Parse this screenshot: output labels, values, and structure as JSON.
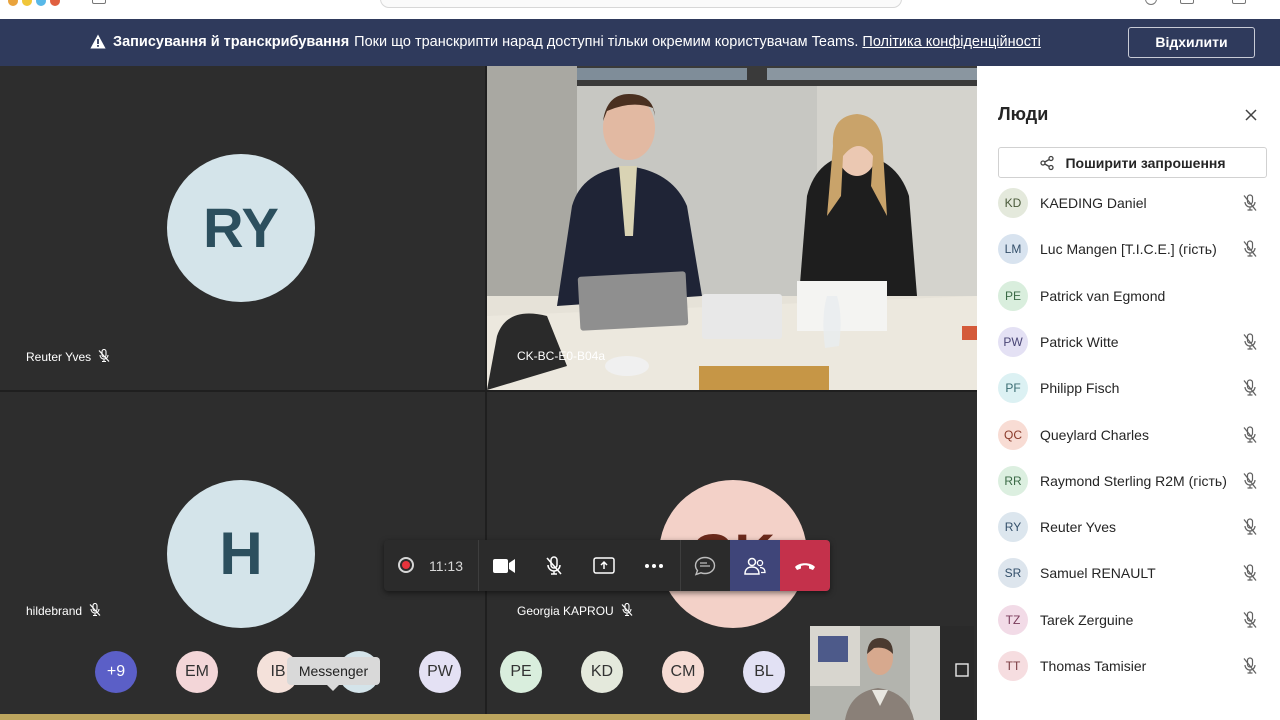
{
  "colors": {
    "banner_bg": "#2f3a5c",
    "tile_bg": "#2d2d2d",
    "accent_active": "#3f4579",
    "hangup": "#c4314b",
    "record_dot": "#e5333c"
  },
  "banner": {
    "bold": "Записування й транскрибування",
    "text": "Поки що транскрипти нарад доступні тільки окремим користувачам Teams.",
    "link": "Політика конфіденційності",
    "dismiss": "Відхилити"
  },
  "tiles": [
    {
      "initials": "RY",
      "name": "Reuter Yves",
      "avatar_color": "#d4e4ea",
      "muted": true
    },
    {
      "name": "CK-BC-E0-B04a",
      "is_video": true
    },
    {
      "initials": "H",
      "name": "hildebrand",
      "avatar_color": "#d4e4ea",
      "muted": true
    },
    {
      "initials": "GK",
      "name": "Georgia KAPROU",
      "avatar_color": "#f3d1c8",
      "muted": true
    }
  ],
  "controls": {
    "timer": "11:13",
    "icons": [
      "record-icon",
      "camera-icon",
      "mic-off-icon",
      "share-screen-icon",
      "more-icon",
      "chat-icon",
      "people-icon",
      "hangup-icon"
    ]
  },
  "overflow": [
    {
      "label": "+9",
      "color": "#5b5fc7",
      "text_color": "#ffffff"
    },
    {
      "label": "EM",
      "color": "#f3d6d8",
      "text_color": "#333333"
    },
    {
      "label": "IB",
      "color": "#f4e1da",
      "text_color": "#333333"
    },
    {
      "label": "",
      "color": "#d4e4ea",
      "text_color": "#333333"
    },
    {
      "label": "PW",
      "color": "#e4e1f4",
      "text_color": "#333333"
    },
    {
      "label": "PE",
      "color": "#d9eedd",
      "text_color": "#333333"
    },
    {
      "label": "KD",
      "color": "#e4e9dc",
      "text_color": "#333333"
    },
    {
      "label": "CM",
      "color": "#f6dcd4",
      "text_color": "#333333"
    },
    {
      "label": "BL",
      "color": "#e2e1f4",
      "text_color": "#333333"
    }
  ],
  "tooltip": "Messenger",
  "panel": {
    "title": "Люди",
    "share": "Поширити запрошення",
    "people": [
      {
        "initials": "KD",
        "name": "KAEDING Daniel",
        "color": "#e4e9dc",
        "text_color": "#4a5a3a",
        "muted": true
      },
      {
        "initials": "LM",
        "name": "Luc Mangen [T.I.C.E.] (гість)",
        "color": "#d8e3ef",
        "text_color": "#34506b",
        "muted": true
      },
      {
        "initials": "PE",
        "name": "Patrick van Egmond",
        "color": "#d9eedd",
        "text_color": "#3b6a46",
        "muted": false
      },
      {
        "initials": "PW",
        "name": "Patrick Witte",
        "color": "#e4e1f4",
        "text_color": "#4a4676",
        "muted": true
      },
      {
        "initials": "PF",
        "name": "Philipp Fisch",
        "color": "#dcf1f3",
        "text_color": "#3a6c72",
        "muted": true
      },
      {
        "initials": "QC",
        "name": "Queylard Charles",
        "color": "#f8dcd4",
        "text_color": "#8a3a2a",
        "muted": true
      },
      {
        "initials": "RR",
        "name": "Raymond Sterling R2M (гість)",
        "color": "#dcefe0",
        "text_color": "#3b6a46",
        "muted": true
      },
      {
        "initials": "RY",
        "name": "Reuter Yves",
        "color": "#dce6ee",
        "text_color": "#34506b",
        "muted": true
      },
      {
        "initials": "SR",
        "name": "Samuel RENAULT",
        "color": "#dde5ed",
        "text_color": "#34506b",
        "muted": true
      },
      {
        "initials": "TZ",
        "name": "Tarek Zerguine",
        "color": "#f2dbe7",
        "text_color": "#7a3a5a",
        "muted": true
      },
      {
        "initials": "TT",
        "name": "Thomas Tamisier",
        "color": "#f6dde0",
        "text_color": "#7a3a40",
        "muted": true
      }
    ]
  }
}
